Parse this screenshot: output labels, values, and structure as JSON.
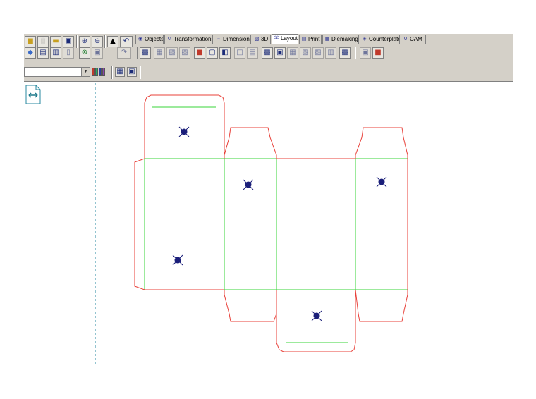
{
  "tabs": [
    {
      "label": "Objects",
      "icon": "objects-icon"
    },
    {
      "label": "Transformations",
      "icon": "transform-icon"
    },
    {
      "label": "Dimensions",
      "icon": "dimension-icon"
    },
    {
      "label": "3D",
      "icon": "cube-icon"
    },
    {
      "label": "Layout",
      "icon": "layout-icon",
      "active": true
    },
    {
      "label": "Print",
      "icon": "print-icon"
    },
    {
      "label": "Diemaking",
      "icon": "diemaking-icon"
    },
    {
      "label": "Counterplate",
      "icon": "counterplate-icon"
    },
    {
      "label": "CAM",
      "icon": "cam-icon"
    }
  ],
  "toolbar": {
    "row1_icons": [
      "open-folder-icon",
      "new-document-icon",
      "open-file-icon",
      "save-icon",
      "zoom-in-icon",
      "zoom-out-icon",
      "pointer-icon",
      "undo-icon"
    ],
    "row2_icons": [
      "shapes-icon",
      "print-icon",
      "print-preview-icon",
      "document-icon",
      "zoom-window-icon",
      "zoom-extents-icon",
      "redo-icon"
    ],
    "layout_icons": [
      "layout-tool-1-icon",
      "layout-tool-2-icon",
      "layout-tool-3-icon",
      "layout-tool-4-icon",
      "layout-tool-5-icon",
      "layout-tool-6-icon",
      "layout-tool-7-icon",
      "layout-tool-8-icon",
      "layout-tool-9-icon",
      "layout-tool-10-icon",
      "layout-tool-11-icon",
      "layout-tool-12-icon",
      "layout-tool-13-icon",
      "layout-tool-14-icon",
      "layout-tool-15-icon",
      "layout-tool-16-icon",
      "layout-tool-17-icon"
    ]
  },
  "property_bar": {
    "layer_combo_value": "",
    "color_bar_colors": [
      "#c0392b",
      "#27ae60",
      "#2c3e9e",
      "#8e44ad"
    ],
    "extra_icons": [
      "layer-settings-icon",
      "layer-view-icon"
    ]
  },
  "left_panel": {
    "icon": "double-arrow-document-icon"
  },
  "canvas": {
    "cut_line_color": "#e8413a",
    "crease_line_color": "#38d438",
    "guide_line_color": "#2a8aa0",
    "marker_color": "#1b1f7a",
    "panel_count": 4,
    "marker_count": 5
  }
}
